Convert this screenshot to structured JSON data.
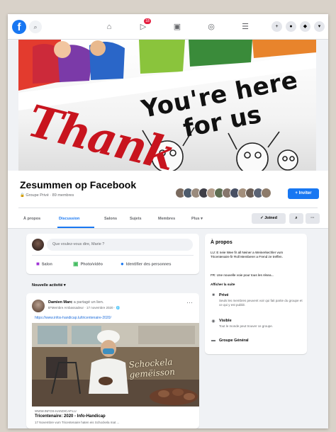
{
  "topnav": {
    "logo": "f",
    "notifications_count": "18",
    "icons": [
      "search-icon",
      "home-icon",
      "video-icon",
      "marketplace-icon",
      "groups-icon",
      "gaming-icon",
      "create-icon",
      "messenger-icon",
      "notifications-icon",
      "account-icon"
    ]
  },
  "cover": {
    "line1": "You're here",
    "line2": "for us",
    "thank": "Thank"
  },
  "group": {
    "title": "Zesummen op Facebook",
    "meta": "🔒 Groupe Privé · 89 membres",
    "invite_label": "+ Inviter"
  },
  "tabs": [
    {
      "label": "À propos",
      "active": false
    },
    {
      "label": "Discussion",
      "active": true
    },
    {
      "label": "Salons",
      "active": false
    },
    {
      "label": "Sujets",
      "active": false
    },
    {
      "label": "Membres",
      "active": false
    },
    {
      "label": "Plus ▾",
      "active": false
    }
  ],
  "tab_actions": {
    "joined": "✓ Joined",
    "search": "⌕",
    "more": "···"
  },
  "composer": {
    "placeholder": "Que voulez-vous dire, Marie ?",
    "actions": [
      "Salon",
      "Photo/vidéo",
      "Identifier des personnes"
    ]
  },
  "sort": {
    "label": "Nouvelle activité ▾"
  },
  "post": {
    "author": "Damien Marc",
    "action": "a partagé un lien.",
    "sub": "B*Membre Ambassadeur · 17 novembre 2020 · 🌐",
    "link": "https://www.infos-handicap.lu/tricentenaire-2020/",
    "image_text_line1": "Schockela",
    "image_text_line2": "gemëisson",
    "domain": "WWW.INFOS-HANDICAP.LU",
    "link_title": "Tricentenaire: 2020 - Info-Handicap",
    "link_desc": "17 Novembre vum Tricentenaire haten eis Schockela mat ..."
  },
  "about": {
    "title": "À propos",
    "desc1": "LU: E neie Wee fir all Neiner a Weinerkechler vum Tricentenaire fir Roll Memberer a Frend ze treffen.",
    "desc2": "FR: Une nouvelle voie pour tous les résea...",
    "see_more": "Afficher la suite",
    "rows": [
      {
        "icon": "lock-icon",
        "title": "Privé",
        "desc": "Seuls les membres peuvent voir qui fait partie du groupe et ce qui y est publié."
      },
      {
        "icon": "eye-icon",
        "title": "Visible",
        "desc": "Tout le monde peut trouver ce groupe."
      },
      {
        "icon": "group-icon",
        "title": "Groupe Général",
        "desc": ""
      }
    ]
  },
  "colors": {
    "brand": "#1877f2",
    "background": "#f0f2f5",
    "badge": "#e41e3f",
    "thank_red": "#c8141e"
  }
}
